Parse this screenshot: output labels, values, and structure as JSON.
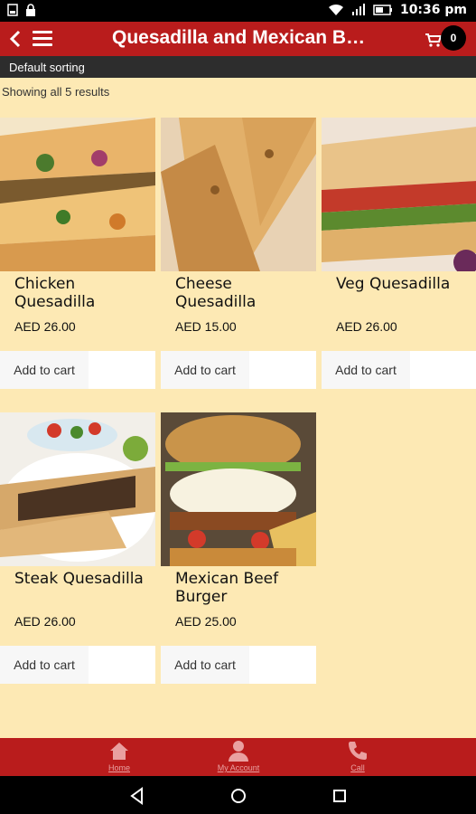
{
  "status_bar": {
    "time": "10:36 pm"
  },
  "app_bar": {
    "title": "Quesadilla and Mexican B…",
    "cart_count": "0"
  },
  "sort": {
    "label": "Default sorting"
  },
  "results_text": "Showing all 5 results",
  "products": [
    {
      "name": "Chicken Quesadilla",
      "price": "AED 26.00",
      "button": "Add to cart"
    },
    {
      "name": "Cheese Quesadilla",
      "price": "AED 15.00",
      "button": "Add to cart"
    },
    {
      "name": "Veg Quesadilla",
      "price": "AED 26.00",
      "button": "Add to cart"
    },
    {
      "name": "Steak Quesadilla",
      "price": "AED 26.00",
      "button": "Add to cart"
    },
    {
      "name": "Mexican Beef Burger",
      "price": "AED 25.00",
      "button": "Add to cart"
    }
  ],
  "bottom_nav": [
    {
      "label": "Home",
      "icon": "home-icon"
    },
    {
      "label": "My Account",
      "icon": "account-icon"
    },
    {
      "label": "Call",
      "icon": "phone-icon"
    }
  ],
  "colors": {
    "brand_red": "#b91c1c",
    "background": "#fde9b4",
    "sort_bar": "#2d2d2d"
  }
}
